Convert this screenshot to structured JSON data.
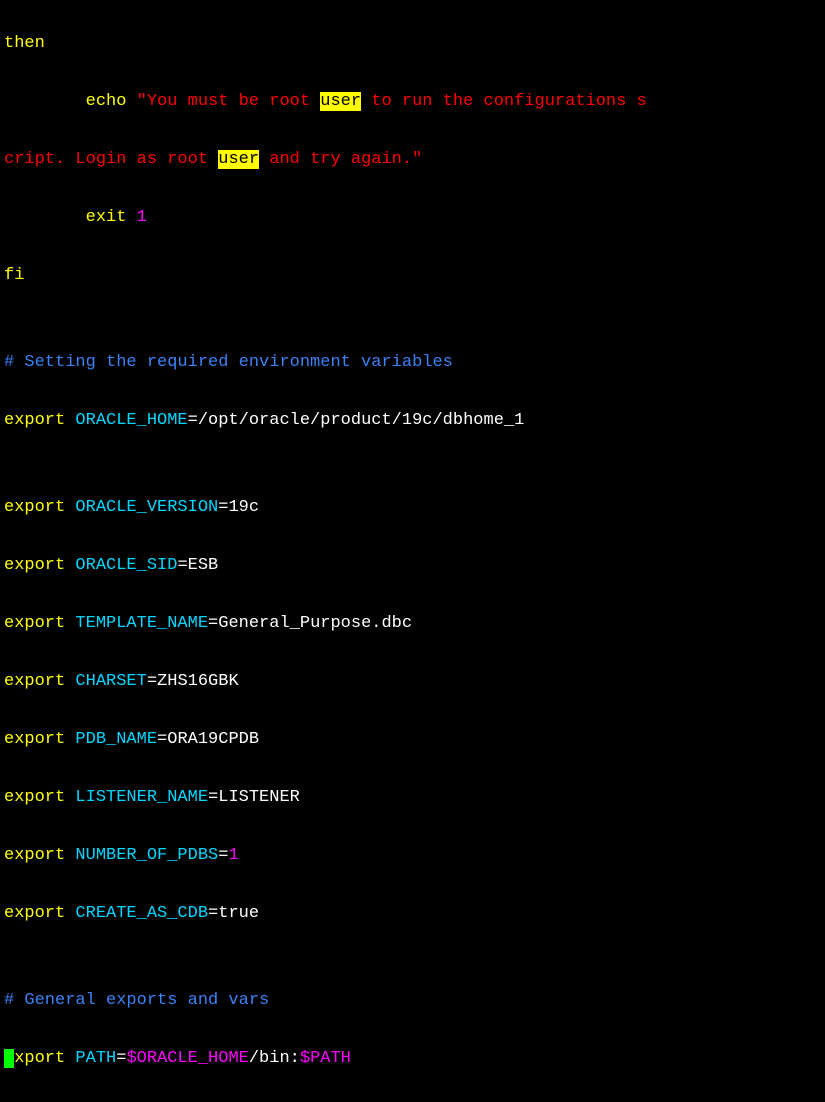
{
  "lines": {
    "l0_then": "then",
    "l1_echo": "        echo ",
    "l1_q1": "\"You must be root ",
    "l1_user1": "user",
    "l1_q2": " to run the configurations s",
    "l2_q1": "cript. Login as root ",
    "l2_user": "user",
    "l2_q2": " and try again.\"",
    "l3_exit": "        exit ",
    "l3_code": "1",
    "l4_fi": "fi",
    "blank": "",
    "c1": "# Setting the required environment variables",
    "e1_kw": "export",
    "e1_var": " ORACLE_HOME",
    "e1_eq": "=",
    "e1_val": "/opt/oracle/product/19c/dbhome_1",
    "e2_var": " ORACLE_VERSION",
    "e2_val": "19c",
    "e3_var": " ORACLE_SID",
    "e3_val": "ESB",
    "e4_var": " TEMPLATE_NAME",
    "e4_val": "General_Purpose.dbc",
    "e5_var": " CHARSET",
    "e5_val": "ZHS16GBK",
    "e6_var": " PDB_NAME",
    "e6_val": "ORA19CPDB",
    "e7_var": " LISTENER_NAME",
    "e7_val": "LISTENER",
    "e8_var": " NUMBER_OF_PDBS",
    "e8_val": "1",
    "e9_var": " CREATE_AS_CDB",
    "e9_val": "true",
    "c2": "# General exports and vars",
    "p_kw_partial": "xport",
    "p_var": " PATH",
    "p_eq": "=",
    "p_val1": "$ORACLE_HOME",
    "p_val2": "/bin:",
    "p_val3": "$PATH"
  }
}
